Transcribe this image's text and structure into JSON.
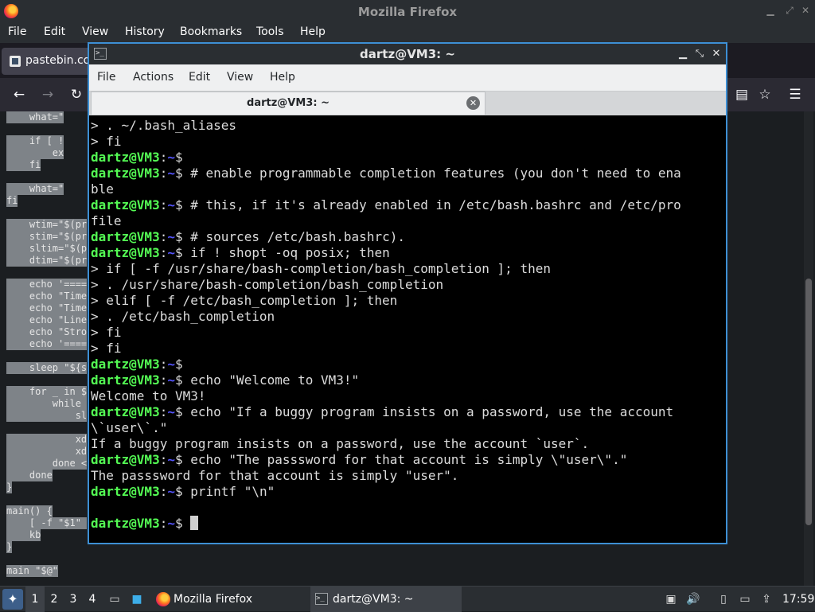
{
  "firefox": {
    "title": "Mozilla Firefox",
    "menu": [
      "File",
      "Edit",
      "View",
      "History",
      "Bookmarks",
      "Tools",
      "Help"
    ],
    "tab_label": "pastebin.co",
    "page_code_lines": [
      "    what=\"",
      "    if [ !",
      "        ex",
      "    fi",
      "    what=\"",
      "fi",
      "    wtim=\"$(pr",
      "    stim=\"$(pr",
      "    sltim=\"$(p",
      "    dtim=\"$(pr",
      "    echo '====",
      "    echo \"Time",
      "    echo \"Time",
      "    echo \"Line",
      "    echo \"Stro",
      "    echo '====",
      "    sleep \"${s",
      "    for _ in $",
      "        while ",
      "            sl",
      "            xd",
      "            xd",
      "        done <",
      "    done",
      "}",
      "main() {",
      "    [ -f \"$1\" ",
      "    kb",
      "}",
      "main \"$@\""
    ]
  },
  "terminal": {
    "title": "dartz@VM3: ~",
    "menu": [
      "File",
      "Actions",
      "Edit",
      "View",
      "Help"
    ],
    "tab_label": "dartz@VM3: ~",
    "prompt_user": "dartz@VM3",
    "prompt_path": "~",
    "lines": [
      {
        "type": "out",
        "text": "> . ~/.bash_aliases"
      },
      {
        "type": "out",
        "text": "> fi"
      },
      {
        "type": "prompt",
        "text": ""
      },
      {
        "type": "prompt",
        "text": " # enable programmable completion features (you don't need to ena"
      },
      {
        "type": "out",
        "text": "ble"
      },
      {
        "type": "prompt",
        "text": " # this, if it's already enabled in /etc/bash.bashrc and /etc/pro"
      },
      {
        "type": "out",
        "text": "file"
      },
      {
        "type": "prompt",
        "text": " # sources /etc/bash.bashrc)."
      },
      {
        "type": "prompt",
        "text": " if ! shopt -oq posix; then"
      },
      {
        "type": "out",
        "text": "> if [ -f /usr/share/bash-completion/bash_completion ]; then"
      },
      {
        "type": "out",
        "text": "> . /usr/share/bash-completion/bash_completion"
      },
      {
        "type": "out",
        "text": "> elif [ -f /etc/bash_completion ]; then"
      },
      {
        "type": "out",
        "text": "> . /etc/bash_completion"
      },
      {
        "type": "out",
        "text": "> fi"
      },
      {
        "type": "out",
        "text": "> fi"
      },
      {
        "type": "prompt",
        "text": ""
      },
      {
        "type": "prompt",
        "text": " echo \"Welcome to VM3!\""
      },
      {
        "type": "out",
        "text": "Welcome to VM3!"
      },
      {
        "type": "prompt",
        "text": " echo \"If a buggy program insists on a password, use the account"
      },
      {
        "type": "out",
        "text": "\\`user\\`.\""
      },
      {
        "type": "out",
        "text": "If a buggy program insists on a password, use the account `user`."
      },
      {
        "type": "prompt",
        "text": " echo \"The passsword for that account is simply \\\"user\\\".\""
      },
      {
        "type": "out",
        "text": "The passsword for that account is simply \"user\"."
      },
      {
        "type": "prompt",
        "text": " printf \"\\n\""
      },
      {
        "type": "out",
        "text": ""
      },
      {
        "type": "prompt_cursor",
        "text": " "
      }
    ]
  },
  "taskbar": {
    "workspaces": [
      "1",
      "2",
      "3",
      "4"
    ],
    "tasks": [
      "Mozilla Firefox",
      "dartz@VM3: ~"
    ],
    "clock": "17:59"
  }
}
